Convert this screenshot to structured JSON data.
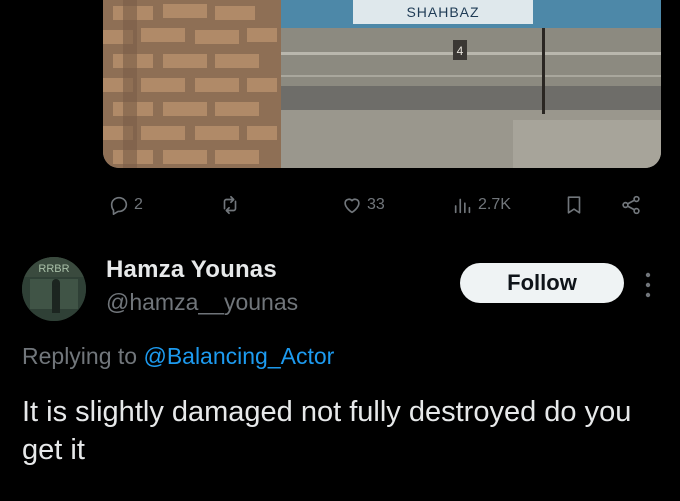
{
  "media": {
    "sign_text": "SHAHBAZ",
    "marker_text": "4"
  },
  "actions": {
    "reply_count": "2",
    "repost_count": "",
    "like_count": "33",
    "view_count": "2.7K"
  },
  "icons": [
    "reply-icon",
    "repost-icon",
    "like-icon",
    "views-icon",
    "bookmark-icon",
    "share-icon",
    "more-options-icon"
  ],
  "reply": {
    "avatar_text": "RRBR",
    "display_name": "Hamza Younas",
    "handle": "@hamza__younas",
    "follow_label": "Follow",
    "replying_prefix": "Replying to",
    "replying_to": "@Balancing_Actor",
    "body": "It is slightly damaged not fully destroyed do you get it"
  },
  "colors": {
    "background": "#000000",
    "text": "#e7e9ea",
    "muted": "#71767b",
    "link": "#1d9bf0",
    "follow_bg": "#eff3f4"
  }
}
